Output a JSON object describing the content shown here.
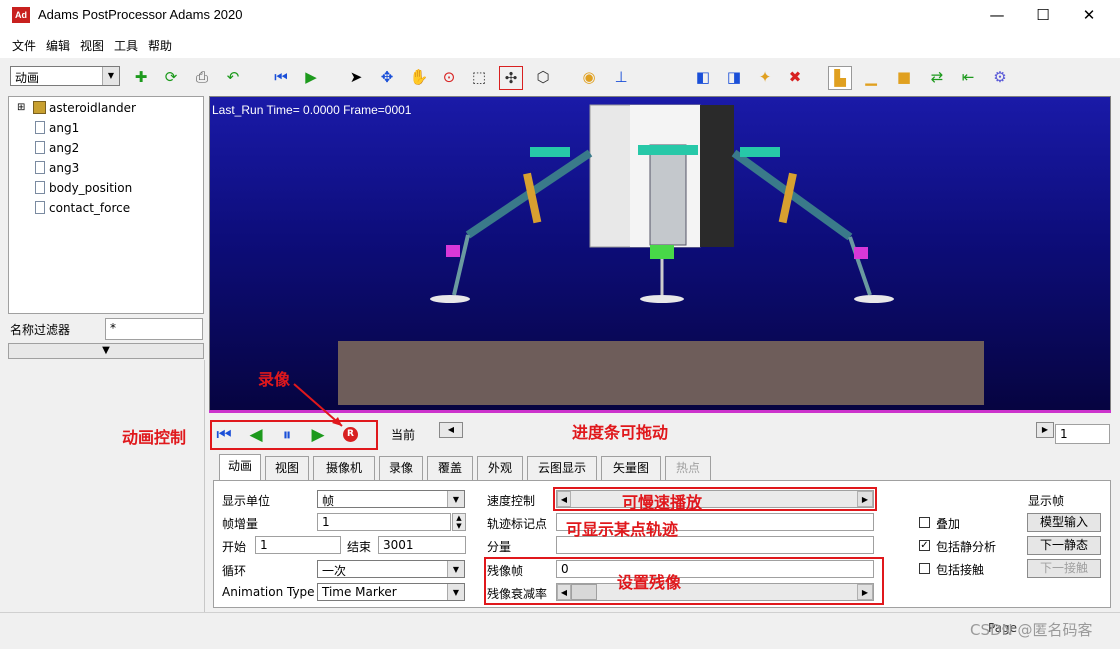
{
  "window": {
    "title": "Adams PostProcessor Adams 2020",
    "icon_text": "Ad"
  },
  "menu": [
    "文件",
    "编辑",
    "视图",
    "工具",
    "帮助"
  ],
  "toolbar": {
    "mode_value": "动画"
  },
  "tree": {
    "root": "asteroidlander",
    "items": [
      "ang1",
      "ang2",
      "ang3",
      "body_position",
      "contact_force"
    ]
  },
  "filter": {
    "label": "名称过滤器",
    "value": "*"
  },
  "viewport": {
    "status": "Last_Run   Time= 0.0000  Frame=0001"
  },
  "controls": {
    "current_label": "当前",
    "rec_glyph": "R",
    "frame_value": "1"
  },
  "tabs": [
    {
      "label": "动画",
      "active": true
    },
    {
      "label": "视图"
    },
    {
      "label": "摄像机"
    },
    {
      "label": "录像"
    },
    {
      "label": "覆盖"
    },
    {
      "label": "外观"
    },
    {
      "label": "云图显示"
    },
    {
      "label": "矢量图"
    },
    {
      "label": "热点",
      "disabled": true
    }
  ],
  "form": {
    "display_unit_label": "显示单位",
    "display_unit_value": "帧",
    "frame_inc_label": "帧增量",
    "frame_inc_value": "1",
    "start_label": "开始",
    "start_value": "1",
    "end_label": "结束",
    "end_value": "3001",
    "loop_label": "循环",
    "loop_value": "一次",
    "anim_type_label": "Animation Type",
    "anim_type_value": "Time Marker",
    "speed_label": "速度控制",
    "trace_label": "轨迹标记点",
    "component_label": "分量",
    "ghost_label": "残像帧",
    "ghost_value": "0",
    "ghost_decay_label": "残像衰减率",
    "show_frame_label": "显示帧",
    "overlay_label": "叠加",
    "overlay_checked": false,
    "static_label": "包括静分析",
    "static_checked": true,
    "contact_label": "包括接触",
    "contact_checked": false,
    "model_input_btn": "模型输入",
    "next_static_btn": "下一静态",
    "next_contact_btn": "下一接触"
  },
  "annotations": {
    "record": "录像",
    "anim_control": "动画控制",
    "progress_drag": "进度条可拖动",
    "slow_play": "可慢速播放",
    "trace_point": "可显示某点轨迹",
    "ghost": "设置残像"
  },
  "status": {
    "page": "Page",
    "watermark": "CSDN @匿名码客"
  },
  "colors": {
    "annotation": "#e0181c",
    "viewport_top": "#1a1aa8",
    "ground": "#6e5d5a"
  }
}
